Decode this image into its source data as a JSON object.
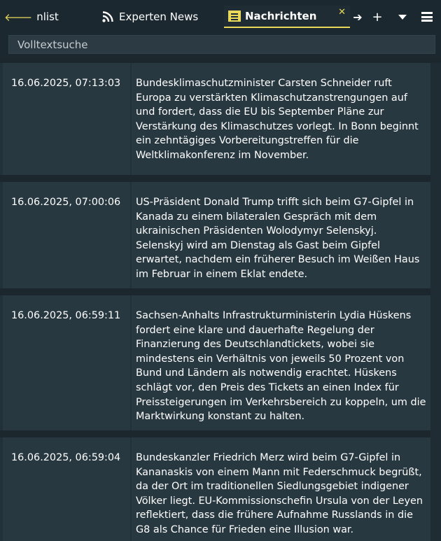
{
  "tabs": {
    "prev_label": "nlist",
    "experten_label": "Experten News",
    "active_label": "Nachrichten",
    "close_glyph": "✕",
    "next_glyph": "➔",
    "add_glyph": "+"
  },
  "search": {
    "placeholder": "Volltextsuche",
    "value": ""
  },
  "news": [
    {
      "timestamp": "16.06.2025, 07:13:03",
      "text": "Bundesklimaschutzminister Carsten Schneider ruft Europa zu verstärkten Klimaschutzanstrengungen auf und fordert, dass die EU bis September Pläne zur Verstärkung des Klimaschutzes vorlegt. In Bonn beginnt ein zehntägiges Vorbereitungstreffen für die Weltklimakonferenz im November."
    },
    {
      "timestamp": "16.06.2025, 07:00:06",
      "text": "US-Präsident Donald Trump trifft sich beim G7-Gipfel in Kanada zu einem bilateralen Gespräch mit dem ukrainischen Präsidenten Wolodymyr Selenskyj. Selenskyj wird am Dienstag als Gast beim Gipfel erwartet, nachdem ein früherer Besuch im Weißen Haus im Februar in einem Eklat endete."
    },
    {
      "timestamp": "16.06.2025, 06:59:11",
      "text": "Sachsen-Anhalts Infrastrukturministerin Lydia Hüskens fordert eine klare und dauerhafte Regelung der Finanzierung des Deutschlandtickets, wobei sie mindestens ein Verhältnis von jeweils 50 Prozent von Bund und Ländern als notwendig erachtet. Hüskens schlägt vor, den Preis des Tickets an einen Index für Preissteigerungen im Verkehrsbereich zu koppeln, um die Marktwirkung konstant zu halten."
    },
    {
      "timestamp": "16.06.2025, 06:59:04",
      "text": "Bundeskanzler Friedrich Merz wird beim G7-Gipfel in Kananaskis von einem Mann mit Federschmuck begrüßt, da der Ort im traditionellen Siedlungsgebiet indigener Völker liegt. EU-Kommissionschefin Ursula von der Leyen reflektiert, dass die frühere Aufnahme Russlands in die G8 als Chance für Frieden eine Illusion war."
    }
  ],
  "colors": {
    "accent": "#e8d95a",
    "background": "#223039",
    "row": "#283841",
    "tabbar": "#1c2830"
  }
}
